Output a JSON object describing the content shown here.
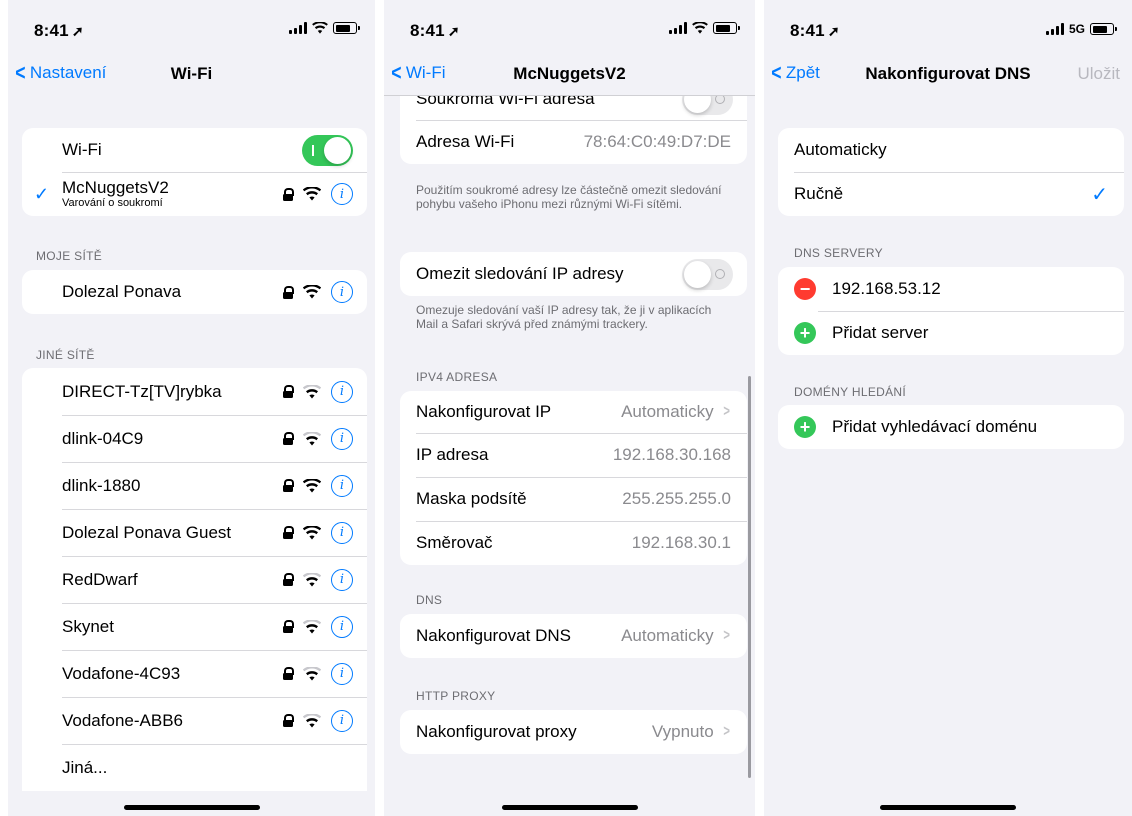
{
  "status": {
    "time": "8:41",
    "network_label": "5G"
  },
  "screen1": {
    "back_label": "Nastavení",
    "title": "Wi-Fi",
    "wifi_label": "Wi-Fi",
    "wifi_enabled": true,
    "connected": {
      "name": "McNuggetsV2",
      "subtitle": "Varování o soukromí"
    },
    "my_networks_header": "MOJE SÍTĚ",
    "my_networks": [
      "Dolezal Ponava"
    ],
    "other_networks_header": "JINÉ SÍTĚ",
    "other_networks": [
      "DIRECT-Tz[TV]rybka",
      "dlink-04C9",
      "dlink-1880",
      "Dolezal Ponava Guest",
      "RedDwarf",
      "Skynet",
      "Vodafone-4C93",
      "Vodafone-ABB6"
    ],
    "other_label": "Jiná..."
  },
  "screen2": {
    "back_label": "Wi-Fi",
    "title": "McNuggetsV2",
    "private_address_label": "Soukromá Wi-Fi adresa",
    "private_address_enabled": false,
    "wifi_address_label": "Adresa Wi-Fi",
    "wifi_address_value": "78:64:C0:49:D7:DE",
    "private_note": "Použitím soukromé adresy lze částečně omezit sledování pohybu vašeho iPhonu mezi různými Wi-Fi sítěmi.",
    "limit_ip_label": "Omezit sledování IP adresy",
    "limit_ip_enabled": false,
    "limit_ip_note": "Omezuje sledování vaší IP adresy tak, že ji v aplikacích Mail a Safari skrývá před známými trackery.",
    "ipv4_header": "IPV4 ADRESA",
    "ipv4_rows": [
      {
        "label": "Nakonfigurovat IP",
        "value": "Automaticky",
        "chevron": true
      },
      {
        "label": "IP adresa",
        "value": "192.168.30.168",
        "chevron": false
      },
      {
        "label": "Maska podsítě",
        "value": "255.255.255.0",
        "chevron": false
      },
      {
        "label": "Směrovač",
        "value": "192.168.30.1",
        "chevron": false
      }
    ],
    "dns_header": "DNS",
    "dns_label": "Nakonfigurovat DNS",
    "dns_value": "Automaticky",
    "proxy_header": "HTTP PROXY",
    "proxy_label": "Nakonfigurovat proxy",
    "proxy_value": "Vypnuto"
  },
  "screen3": {
    "back_label": "Zpět",
    "title": "Nakonfigurovat DNS",
    "save_label": "Uložit",
    "mode_options": [
      "Automaticky",
      "Ručně"
    ],
    "mode_selected": "Ručně",
    "dns_servers_header": "DNS SERVERY",
    "dns_servers": [
      "192.168.53.12"
    ],
    "add_server_label": "Přidat server",
    "search_domains_header": "DOMÉNY HLEDÁNÍ",
    "add_domain_label": "Přidat vyhledávací doménu"
  },
  "colors": {
    "accent": "#007aff",
    "toggle_on": "#34c759",
    "destructive": "#ff3b30",
    "background": "#f2f2f7"
  },
  "icons": [
    "location-arrow-icon",
    "cellular-icon",
    "wifi-icon",
    "battery-icon",
    "lock-icon",
    "info-icon",
    "checkmark-icon",
    "chevron-left-icon",
    "chevron-right-icon",
    "minus-circle-icon",
    "plus-circle-icon"
  ]
}
